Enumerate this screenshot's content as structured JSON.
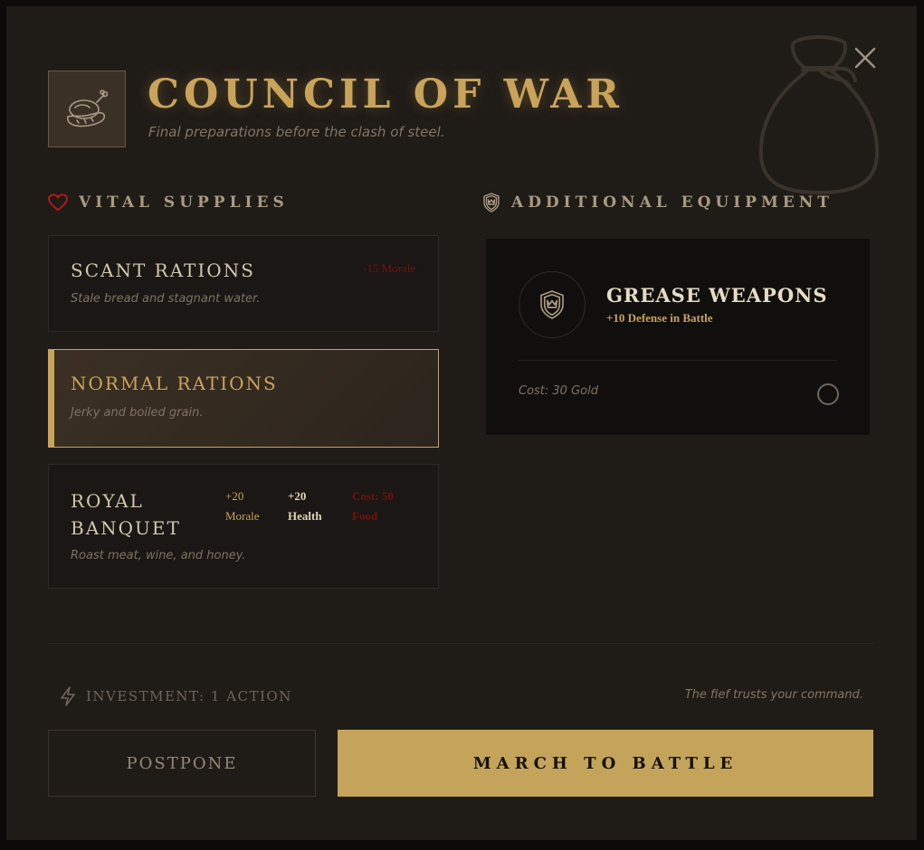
{
  "header": {
    "title": "COUNCIL OF WAR",
    "subtitle": "Final preparations before the clash of steel.",
    "icon": "meat-and-bread-icon"
  },
  "supplies": {
    "heading": "VITAL SUPPLIES",
    "heading_icon": "heart-icon",
    "options": [
      {
        "title": "SCANT RATIONS",
        "desc": "Stale bread and stagnant water.",
        "tags": [
          {
            "text": "-15 Morale",
            "color": "#7a0e0e"
          }
        ],
        "selected": false
      },
      {
        "title": "NORMAL RATIONS",
        "desc": "Jerky and boiled grain.",
        "tags": [],
        "selected": true
      },
      {
        "title": "ROYAL BANQUET",
        "desc": "Roast meat, wine, and honey.",
        "tags": [
          {
            "text": "+20 Morale",
            "color": "#c9a35a"
          },
          {
            "text": "+20 Health",
            "color": "#e0d2b4"
          },
          {
            "text": "Cost: 50 Food",
            "color": "#7a0e0e"
          }
        ],
        "selected": false
      }
    ]
  },
  "equipment": {
    "heading": "ADDITIONAL EQUIPMENT",
    "heading_icon": "shield-crown-icon",
    "items": [
      {
        "title": "GREASE WEAPONS",
        "effect": "+10 Defense in Battle",
        "cost": "Cost: 30 Gold",
        "icon": "shield-crown-icon",
        "selected": false
      }
    ]
  },
  "footer": {
    "investment": "INVESTMENT: 1 ACTION",
    "investment_icon": "lightning-icon",
    "flavor": "The fief trusts your command.",
    "postpone_label": "POSTPONE",
    "march_label": "MARCH TO BATTLE"
  },
  "colors": {
    "accent_gold": "#c9a35a",
    "panel_bg": "#1f1b17",
    "penalty_red": "#7a0e0e",
    "heart_red": "#b01a1a"
  }
}
